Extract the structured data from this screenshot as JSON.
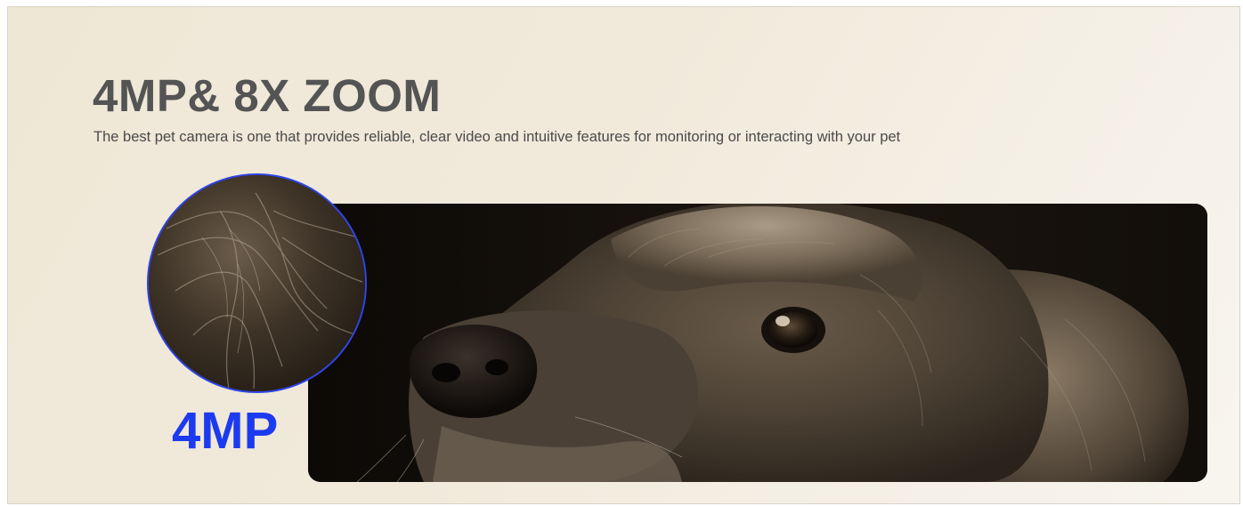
{
  "section": {
    "headline": "4MP& 8X ZOOM",
    "subtitle": "The best pet camera is one that provides reliable, clear video and intuitive features for monitoring or interacting with your pet",
    "zoom_label": "4MP"
  },
  "colors": {
    "background": "#efe7d6",
    "headline": "#545454",
    "subtitle": "#4a4a4a",
    "accent_blue": "#1c3aef",
    "circle_border": "#2f45e8"
  },
  "images": {
    "main_photo": "dog-face-closeup-sepia",
    "zoom_detail": "dog-fur-detail-sepia"
  }
}
